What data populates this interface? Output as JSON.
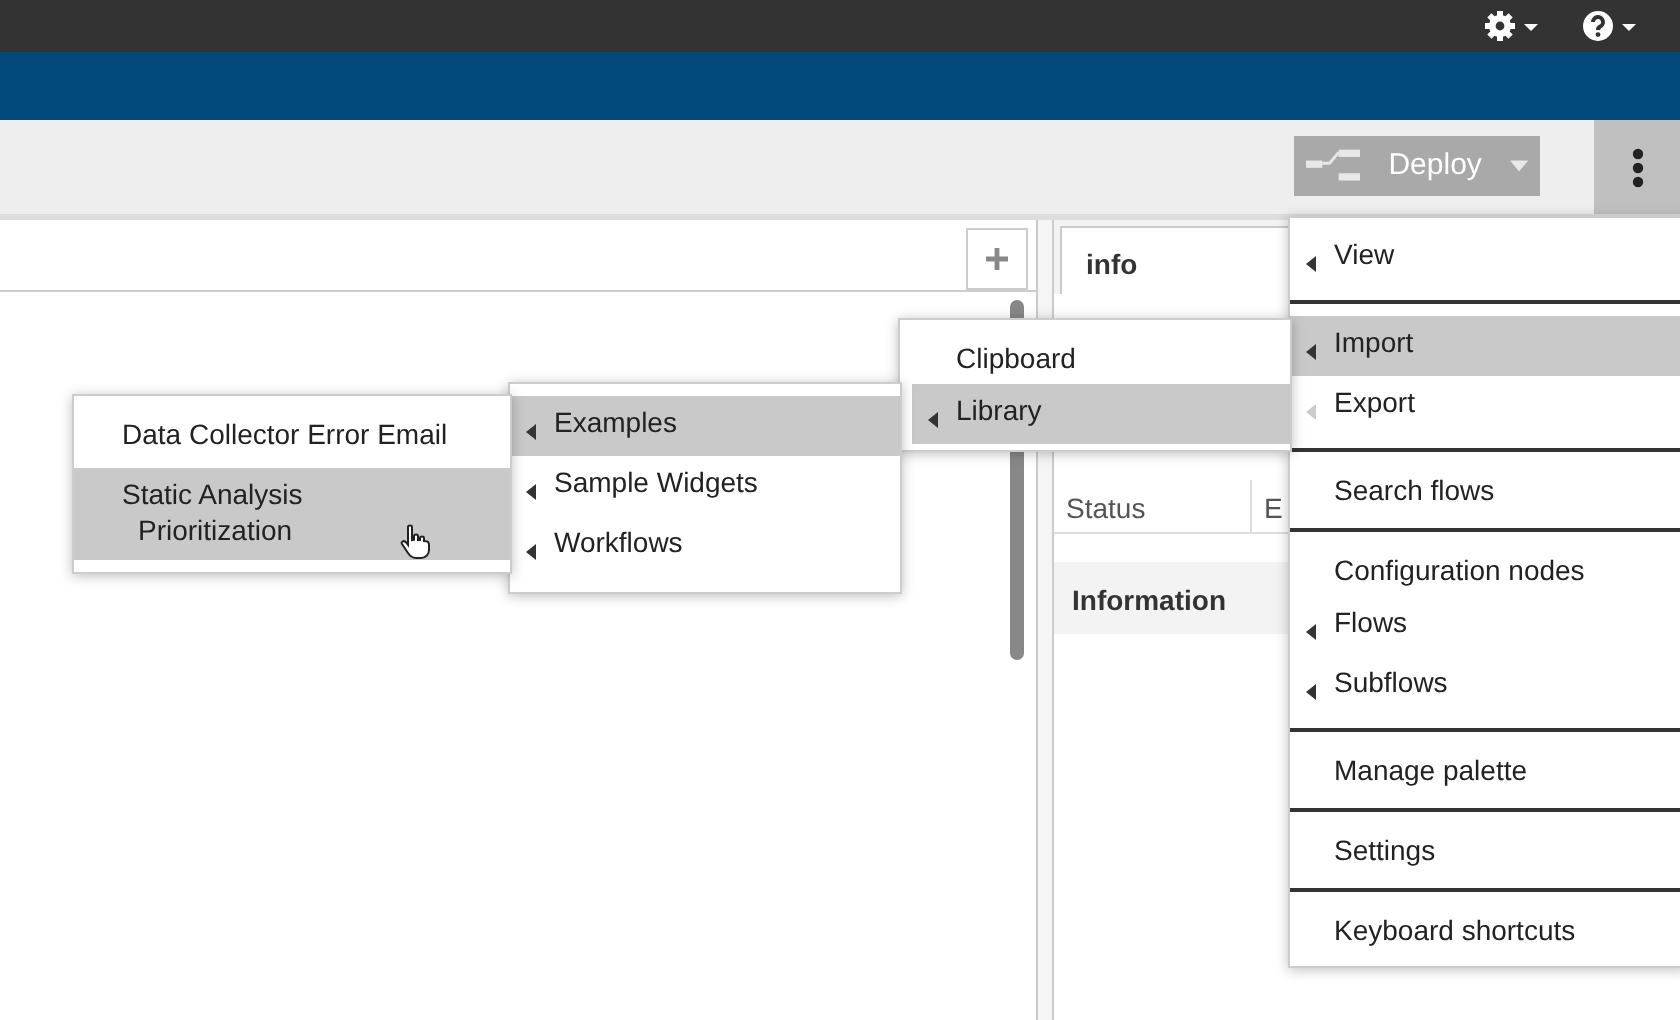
{
  "toolbar": {
    "deploy": {
      "label": "Deploy",
      "disabled": true
    }
  },
  "sidebar": {
    "tab": {
      "label": "info",
      "selected": true
    },
    "rows": [
      {
        "label": "Status",
        "value": "E"
      }
    ],
    "section": "Information"
  },
  "main_menu": {
    "sections": [
      [
        {
          "label": "View",
          "kind": "submenu",
          "selected": false
        }
      ],
      [
        {
          "label": "Import",
          "kind": "submenu",
          "selected": true
        },
        {
          "label": "Export",
          "kind": "faded",
          "selected": false
        }
      ],
      [
        {
          "label": "Search flows",
          "kind": "plain",
          "selected": false
        }
      ],
      [
        {
          "label": "Configuration nodes",
          "kind": "plain",
          "selected": false
        },
        {
          "label": "Flows",
          "kind": "submenu",
          "selected": false
        },
        {
          "label": "Subflows",
          "kind": "submenu",
          "selected": false
        }
      ],
      [
        {
          "label": "Manage palette",
          "kind": "plain",
          "selected": false
        }
      ],
      [
        {
          "label": "Settings",
          "kind": "plain",
          "selected": false
        }
      ],
      [
        {
          "label": "Keyboard shortcuts",
          "kind": "plain",
          "selected": false
        }
      ]
    ]
  },
  "import_menu": [
    {
      "label": "Clipboard",
      "kind": "plain",
      "selected": false
    },
    {
      "label": "Library",
      "kind": "submenu",
      "selected": true
    }
  ],
  "library_menu": [
    {
      "label": "Examples",
      "kind": "submenu",
      "selected": true
    },
    {
      "label": "Sample Widgets",
      "kind": "submenu",
      "selected": false
    },
    {
      "label": "Workflows",
      "kind": "submenu",
      "selected": false
    }
  ],
  "examples_menu": [
    {
      "label": "Data Collector Error Email",
      "selected": false
    },
    {
      "label": "Static Analysis Prioritization",
      "selected": true
    }
  ]
}
